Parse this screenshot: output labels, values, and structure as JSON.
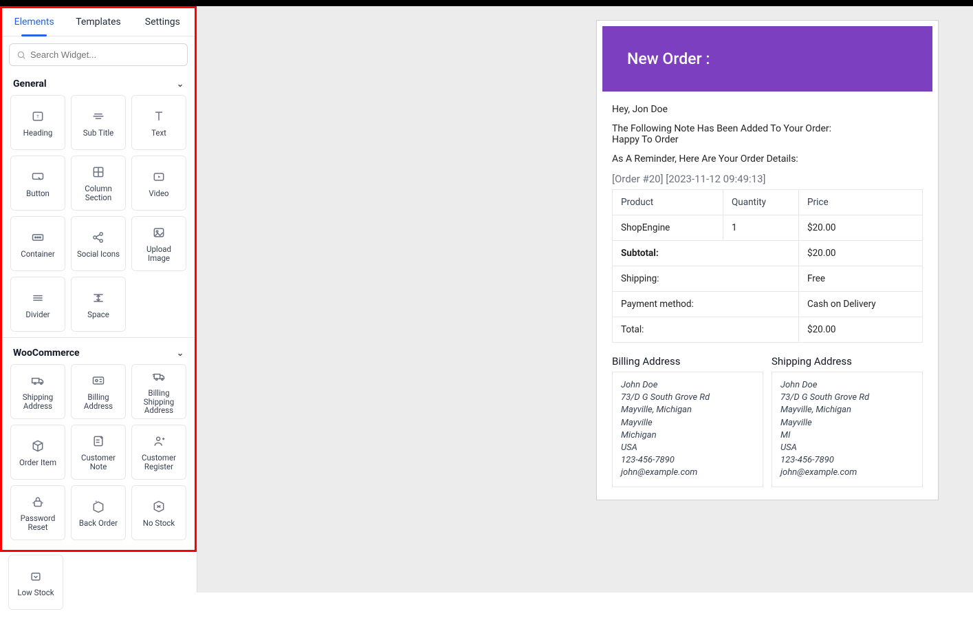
{
  "tabs": {
    "elements": "Elements",
    "templates": "Templates",
    "settings": "Settings"
  },
  "search": {
    "placeholder": "Search Widget..."
  },
  "sections": {
    "general": {
      "title": "General",
      "widgets": [
        "Heading",
        "Sub Title",
        "Text",
        "Button",
        "Column Section",
        "Video",
        "Container",
        "Social Icons",
        "Upload Image",
        "Divider",
        "Space"
      ]
    },
    "woocommerce": {
      "title": "WooCommerce",
      "widgets": [
        "Shipping Address",
        "Billing Address",
        "Billing Shipping Address",
        "Order Item",
        "Customer Note",
        "Customer Register",
        "Password Reset",
        "Back Order",
        "No Stock"
      ]
    },
    "extra": {
      "widgets": [
        "Low Stock"
      ]
    }
  },
  "email": {
    "title": "New Order :",
    "greeting": "Hey, Jon Doe",
    "note_intro": "The Following Note Has Been Added To Your Order:",
    "note_body": "Happy To Order",
    "reminder": "As A Reminder, Here Are Your Order Details:",
    "order_meta": "[Order #20] [2023-11-12 09:49:13]",
    "cols": {
      "product": "Product",
      "qty": "Quantity",
      "price": "Price"
    },
    "item": {
      "product": "ShopEngine",
      "qty": "1",
      "price": "$20.00"
    },
    "subtotal_label": "Subtotal:",
    "subtotal_value": "$20.00",
    "shipping_label": "Shipping:",
    "shipping_value": "Free",
    "payment_label": "Payment method:",
    "payment_value": "Cash on Delivery",
    "total_label": "Total:",
    "total_value": "$20.00",
    "billing_title": "Billing Address",
    "shipping_title": "Shipping Address",
    "billing": {
      "name": "John Doe",
      "street": "73/D G South Grove Rd",
      "citystate": "Mayville, Michigan",
      "city": "Mayville",
      "state": "Michigan",
      "country": "USA",
      "phone": "123-456-7890",
      "email": "john@example.com"
    },
    "shipping": {
      "name": "John Doe",
      "street": "73/D G South Grove Rd",
      "citystate": "Mayville, Michigan",
      "city": "Mayville",
      "state": "MI",
      "country": "USA",
      "phone": "123-456-7890",
      "email": "john@example.com"
    }
  }
}
